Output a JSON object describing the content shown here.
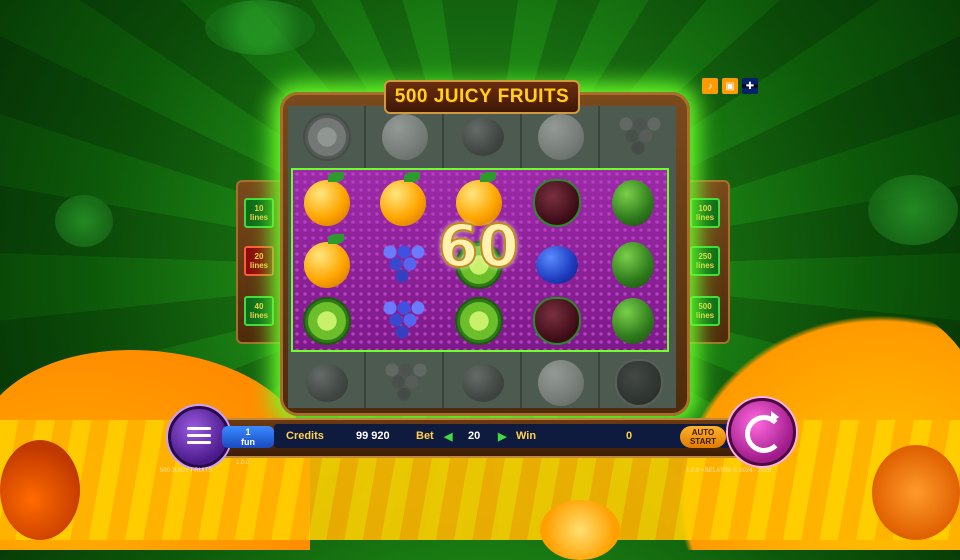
{
  "game": {
    "title": "500 JUICY FRUITS",
    "win_amount_display": "60"
  },
  "lines": {
    "left": [
      {
        "value": "10",
        "unit": "lines",
        "active": false
      },
      {
        "value": "20",
        "unit": "lines",
        "active": true
      },
      {
        "value": "40",
        "unit": "lines",
        "active": false
      }
    ],
    "right": [
      {
        "value": "100",
        "unit": "lines",
        "active": false
      },
      {
        "value": "250",
        "unit": "lines",
        "active": false
      },
      {
        "value": "500",
        "unit": "lines",
        "active": false
      }
    ]
  },
  "top_icons": [
    "sound-icon",
    "fullscreen-icon",
    "uk-flag-icon"
  ],
  "reels": {
    "visible_rows": [
      [
        "orange",
        "orange",
        "orange",
        "strawberry",
        "melon"
      ],
      [
        "orange",
        "grapes",
        "lime",
        "plum",
        "melon"
      ],
      [
        "lime",
        "grapes",
        "lime",
        "strawberry",
        "melon"
      ]
    ]
  },
  "bottom_bar": {
    "fun_value": "1",
    "fun_label": "fun",
    "credits_label": "Credits",
    "credits_value": "99 920",
    "bet_label": "Bet",
    "bet_value": "20",
    "win_label": "Win",
    "win_value": "0",
    "auto_line1": "AUTO",
    "auto_line2": "START",
    "footer_left": "500 JUICY FRUITS",
    "footer_center": "1.0.0",
    "footer_right": "1.0.0 • BELATRA © 2024 - 2026"
  },
  "colors": {
    "accent_glow": "#6cff2a",
    "win_zone": "#9c2aa8",
    "panel_bg": "#0e1a3e",
    "credits_text": "#ffd24a"
  }
}
